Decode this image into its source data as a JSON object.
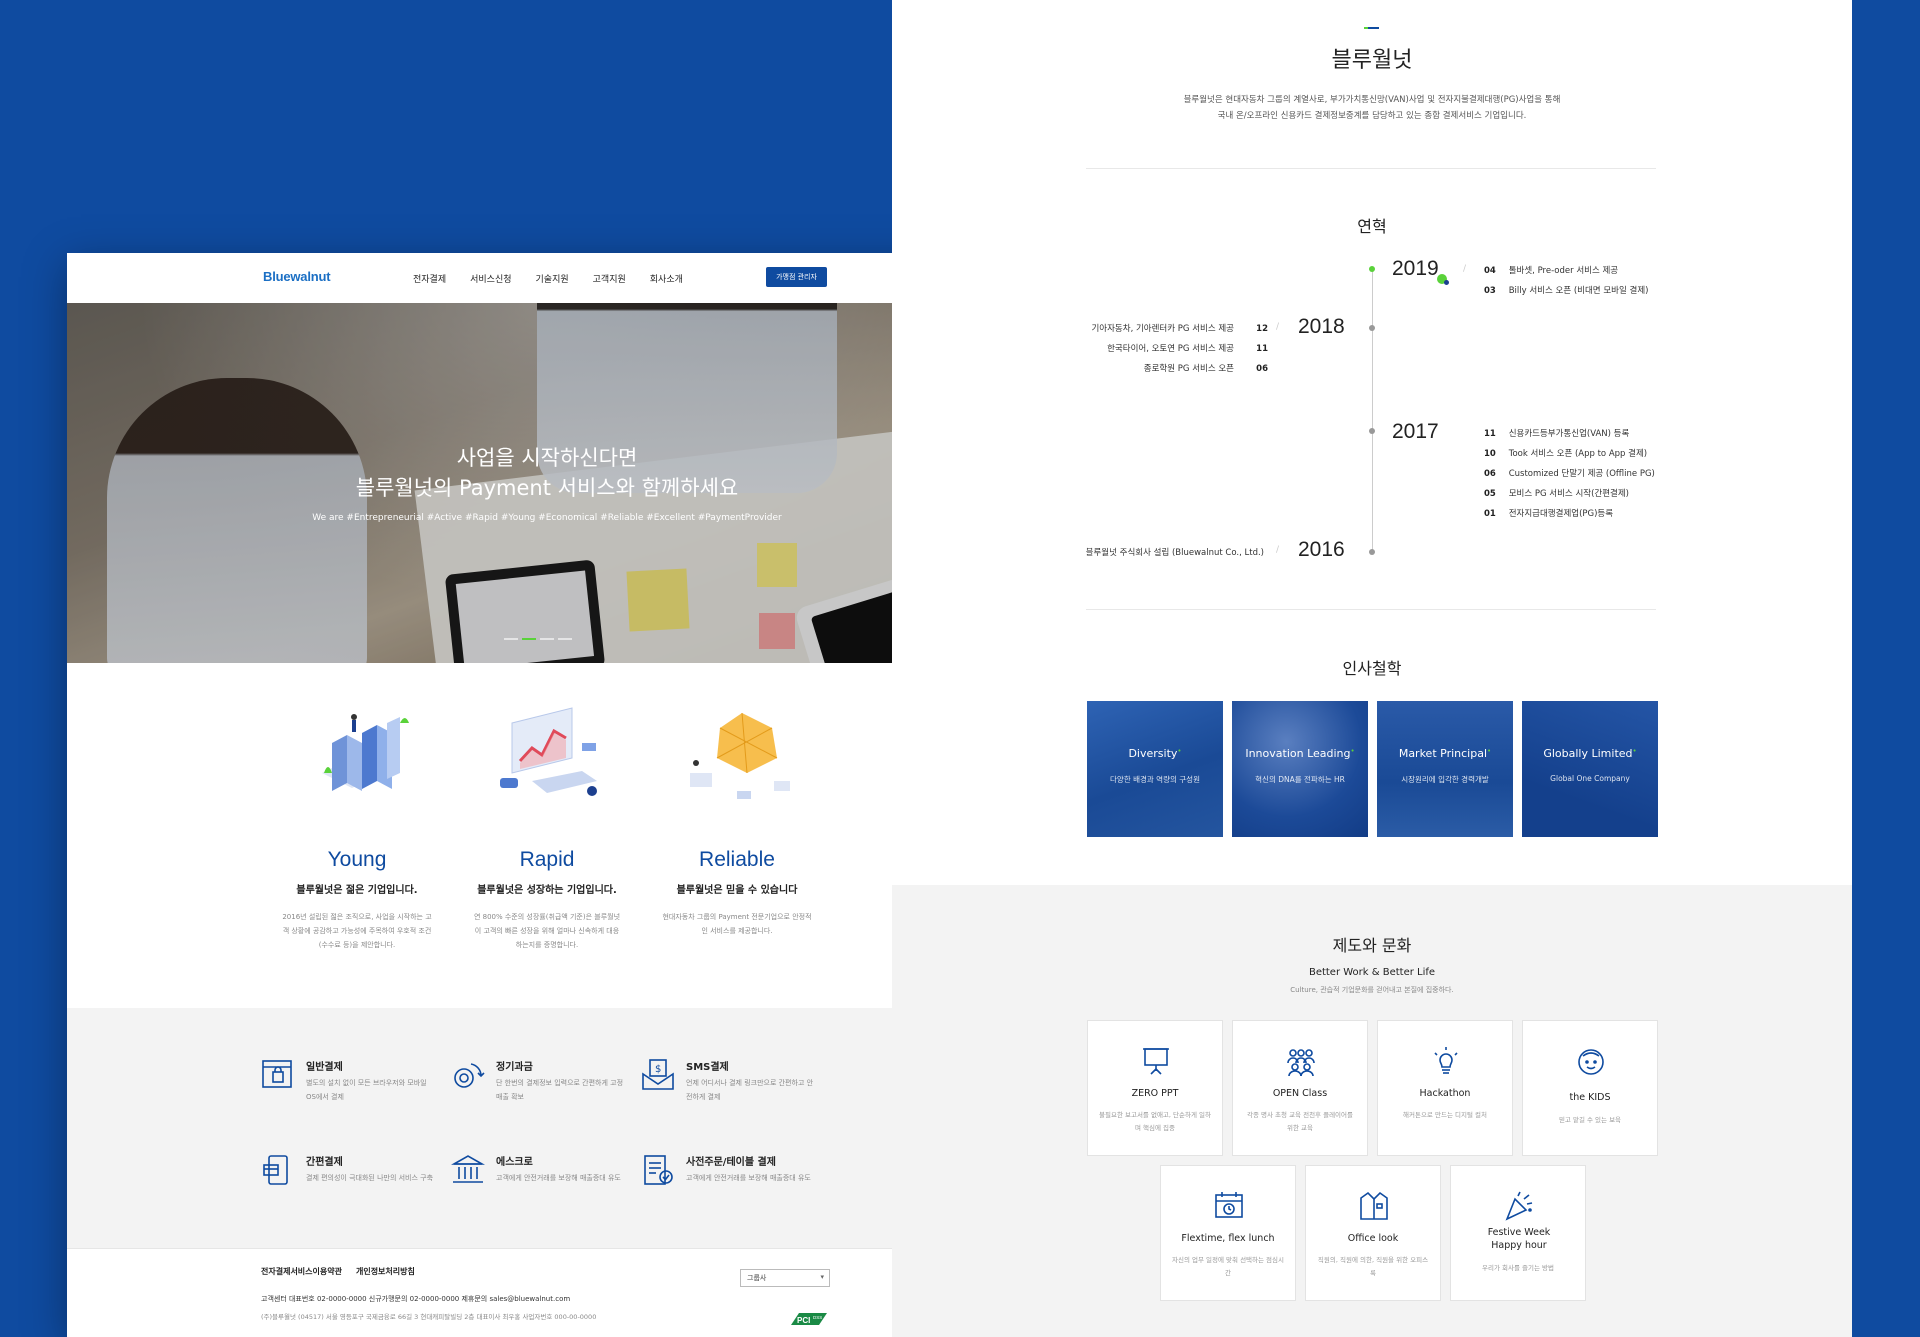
{
  "left": {
    "logo": "Bluewalnut",
    "nav": [
      "전자결제",
      "서비스신청",
      "기술지원",
      "고객지원",
      "회사소개"
    ],
    "merchant_button": "가맹점 관리자",
    "hero": {
      "line1": "사업을 시작하신다면",
      "line2": "블루월넛의 Payment 서비스와 함께하세요",
      "tags": "We are #Entrepreneurial #Active #Rapid #Young #Economical #Reliable #Excellent #PaymentProvider"
    },
    "values": [
      {
        "title": "Young",
        "subtitle": "블루월넛은 젊은 기업입니다.",
        "desc": "2016년 설립된 젊은 조직으로, 사업을 시작하는 고객 상황에 공감하고 가능성에 주목하여 우호적 조건(수수료 등)을 제안합니다."
      },
      {
        "title": "Rapid",
        "subtitle": "블루월넛은 성장하는 기업입니다.",
        "desc": "연 800% 수준의 성장률(취급액 기준)은 블루월넛이 고객의 빠른 성장을 위해 얼마나 신속하게 대응하는지를 증명합니다."
      },
      {
        "title": "Reliable",
        "subtitle": "블루월넛은 믿을 수 있습니다",
        "desc": "현대자동차 그룹의 Payment 전문기업으로 안정적인 서비스를 제공합니다."
      }
    ],
    "services": [
      {
        "icon": "browser-cart-icon",
        "title": "일반결제",
        "desc": "별도의 설치 없이 모든 브라우저와 모바일 OS에서 결제"
      },
      {
        "icon": "recurring-coin-icon",
        "title": "정기과금",
        "desc": "단 한번의 결제정보 입력으로 간편하게 고정 매출 확보"
      },
      {
        "icon": "sms-envelope-icon",
        "title": "SMS결제",
        "desc": "언제 어디서나 결제 링크만으로 간편하고 안전하게 결제"
      },
      {
        "icon": "easy-pay-card-icon",
        "title": "간편결제",
        "desc": "결제 편의성이 극대화된 나만의 서비스 구축"
      },
      {
        "icon": "bank-escrow-icon",
        "title": "에스크로",
        "desc": "고객에게 안전거래를 보장해 매출증대 유도"
      },
      {
        "icon": "preorder-table-icon",
        "title": "사전주문/테이블 결제",
        "desc": "고객에게 안전거래를 보장해 매출증대 유도"
      }
    ],
    "footer": {
      "links": [
        "전자결제서비스이용약관",
        "개인정보처리방침"
      ],
      "info1": "고객센터   대표번호 02-0000-0000   신규가맹문의 02-0000-0000   제휴문의 sales@bluewalnut.com",
      "info2": "(주)블루월넛 (04517) 서울 영등포구 국제금융로 66길 3 현대캐피탈빌딩 2층   대표이사 최우홍   사업자번호 000-00-0000",
      "family_select": "그룹사",
      "pci": "PCI DSS"
    }
  },
  "right": {
    "title": "블루월넛",
    "intro1": "블루월넛은 현대자동차 그룹의 계열사로, 부가가치통신망(VAN)사업 및 전자지불결제대행(PG)사업을 통해",
    "intro2": "국내 온/오프라인 신용카드 결제정보중계를 담당하고 있는 종합 결제서비스 기업입니다.",
    "history_title": "연혁",
    "history": {
      "y2019": "2019",
      "y2019_events": [
        {
          "month": "04",
          "text": "톨바셋, Pre-oder 서비스 제공"
        },
        {
          "month": "03",
          "text": "Billy 서비스 오픈 (비대면 모바일 결제)"
        }
      ],
      "y2018": "2018",
      "y2018_events": [
        {
          "month": "12",
          "text": "기아자동차, 기아렌터카 PG 서비스 제공"
        },
        {
          "month": "11",
          "text": "한국타이어, 오토연 PG 서비스 제공"
        },
        {
          "month": "06",
          "text": "종로학원 PG 서비스 오픈"
        }
      ],
      "y2017": "2017",
      "y2017_events": [
        {
          "month": "11",
          "text": "신용카드등부가통신업(VAN) 등록"
        },
        {
          "month": "10",
          "text": "Took 서비스 오픈 (App to App 결제)"
        },
        {
          "month": "06",
          "text": "Customized 단말기 제공 (Offline PG)"
        },
        {
          "month": "05",
          "text": "모비스 PG 서비스 시작(간편결제)"
        },
        {
          "month": "01",
          "text": "전자지급대행결제업(PG)등록"
        }
      ],
      "y2016": "2016",
      "y2016_events": [
        {
          "month": "",
          "text": "블루월넛 주식회사 설립 (Bluewalnut Co., Ltd.)"
        }
      ]
    },
    "hr_title": "인사철학",
    "hr_cards": [
      {
        "title": "Diversity",
        "sub": "다양한 배경과 역량의 구성원"
      },
      {
        "title": "Innovation Leading",
        "sub": "혁신의 DNA를 전파하는 HR"
      },
      {
        "title": "Market Principal",
        "sub": "시장원리에 입각한 경력개발"
      },
      {
        "title": "Globally Limited",
        "sub": "Global One Company"
      }
    ],
    "culture_title": "제도와 문화",
    "culture_sub": "Better Work & Better Life",
    "culture_desc": "Culture, 관습적 기업문화를 걷어내고 본질에 집중하다.",
    "culture_cards": [
      {
        "icon": "presentation-board-icon",
        "name": "ZERO PPT",
        "text": "불필요한 보고서를 없애고, 단순하게 일하며 핵심에 집중"
      },
      {
        "icon": "group-people-icon",
        "name": "OPEN Class",
        "text": "각종 명사 초청 교육 전천후 플레이어를 위한 교육"
      },
      {
        "icon": "lightbulb-icon",
        "name": "Hackathon",
        "text": "해커톤으로 만드는 디지털 컬처"
      },
      {
        "icon": "kid-face-icon",
        "name": "the KIDS",
        "text": "믿고 맡길 수 있는 보육"
      },
      {
        "icon": "calendar-clock-icon",
        "name": "Flextime, flex lunch",
        "text": "자신의 업무 일정에 맞춰 선택하는 점심시간"
      },
      {
        "icon": "shirt-icon",
        "name": "Office look",
        "text": "직원의, 직원에 의한, 직원을 위한 오피스룩"
      },
      {
        "icon": "party-popper-icon",
        "name": "Festive Week Happy hour",
        "text": "우리가 회사를 즐기는 방법"
      }
    ]
  },
  "colors": {
    "brand": "#0f4ba0",
    "accent_green": "#5ad23a",
    "bg_gray": "#f3f3f3"
  }
}
